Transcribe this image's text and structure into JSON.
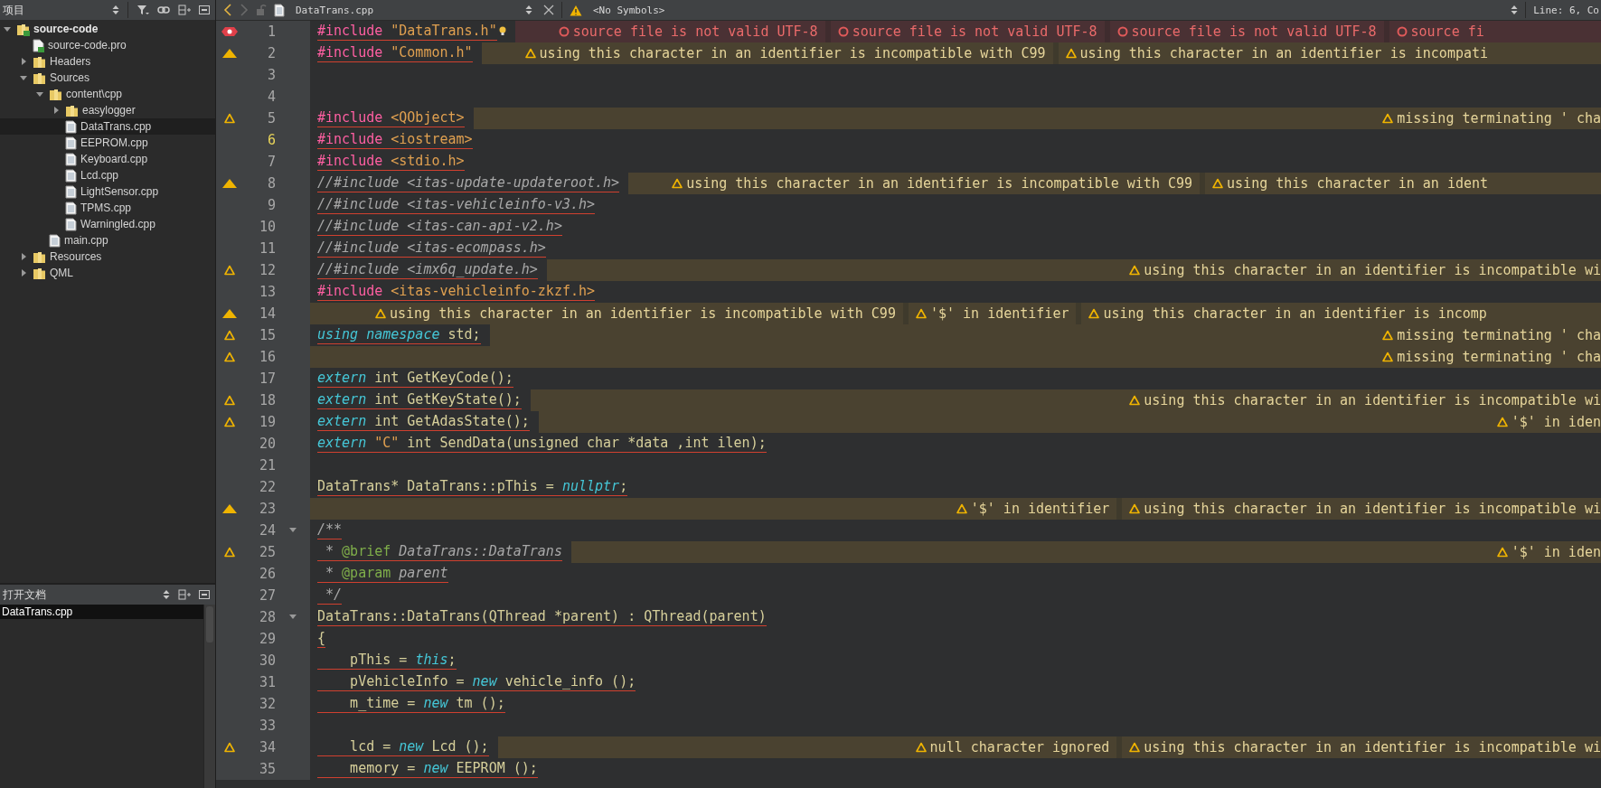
{
  "project_panel": {
    "title": "项目",
    "tree": [
      {
        "label": "source-code",
        "kind": "project",
        "expanded": true,
        "selected": false,
        "children": [
          {
            "label": "source-code.pro",
            "kind": "profile",
            "selected": false
          },
          {
            "label": "Headers",
            "kind": "folder",
            "expanded": false,
            "selected": false
          },
          {
            "label": "Sources",
            "kind": "folder",
            "expanded": true,
            "selected": false,
            "children": [
              {
                "label": "content\\cpp",
                "kind": "folder",
                "expanded": true,
                "selected": false,
                "children": [
                  {
                    "label": "easylogger",
                    "kind": "folder",
                    "expanded": false,
                    "selected": false
                  },
                  {
                    "label": "DataTrans.cpp",
                    "kind": "file",
                    "selected": true
                  },
                  {
                    "label": "EEPROM.cpp",
                    "kind": "file",
                    "selected": false
                  },
                  {
                    "label": "Keyboard.cpp",
                    "kind": "file",
                    "selected": false
                  },
                  {
                    "label": "Lcd.cpp",
                    "kind": "file",
                    "selected": false
                  },
                  {
                    "label": "LightSensor.cpp",
                    "kind": "file",
                    "selected": false
                  },
                  {
                    "label": "TPMS.cpp",
                    "kind": "file",
                    "selected": false
                  },
                  {
                    "label": "Warningled.cpp",
                    "kind": "file",
                    "selected": false
                  }
                ]
              },
              {
                "label": "main.cpp",
                "kind": "file",
                "selected": false
              }
            ]
          },
          {
            "label": "Resources",
            "kind": "folder",
            "expanded": false,
            "selected": false
          },
          {
            "label": "QML",
            "kind": "folder",
            "expanded": false,
            "selected": false
          }
        ]
      }
    ]
  },
  "open_documents": {
    "title": "打开文档",
    "items": [
      {
        "label": "DataTrans.cpp",
        "selected": true
      }
    ]
  },
  "editor_toolbar": {
    "file": "DataTrans.cpp",
    "symbols": "<No Symbols>",
    "position": "Line: 6, Co"
  },
  "lines": [
    {
      "number": "1",
      "kind": "error",
      "current": false,
      "fold": false,
      "underlined": true,
      "bulb": true,
      "right_aligned": false,
      "code": [
        {
          "kind": "pp",
          "text": "#include "
        },
        {
          "kind": "str",
          "text": "\"DataTrans.h\""
        }
      ],
      "annotations": [
        {
          "kind": "error",
          "text": "source file is not valid UTF-8"
        },
        {
          "kind": "error",
          "text": "source file is not valid UTF-8"
        },
        {
          "kind": "error",
          "text": "source file is not valid UTF-8"
        },
        {
          "kind": "error",
          "text": "source fi"
        }
      ]
    },
    {
      "number": "2",
      "kind": "warning",
      "current": false,
      "fold": false,
      "underlined": true,
      "bulb": false,
      "right_aligned": false,
      "code": [
        {
          "kind": "pp",
          "text": "#include "
        },
        {
          "kind": "str",
          "text": "\"Common.h\""
        }
      ],
      "annotations": [
        {
          "kind": "warning",
          "text": "using this character in an identifier is incompatible with C99"
        },
        {
          "kind": "warning",
          "text": "using this character in an identifier is incompati"
        }
      ]
    },
    {
      "number": "3",
      "kind": "plain",
      "current": false,
      "fold": false,
      "bulb": false
    },
    {
      "number": "4",
      "kind": "plain",
      "current": false,
      "fold": false,
      "bulb": false
    },
    {
      "number": "5",
      "kind": "warning-outline",
      "current": false,
      "fold": false,
      "underlined": true,
      "bulb": false,
      "right_aligned": true,
      "code": [
        {
          "kind": "pp",
          "text": "#include "
        },
        {
          "kind": "str",
          "text": "<QObject>"
        }
      ],
      "annotations": [
        {
          "kind": "warning",
          "text": "missing terminating ' cha"
        }
      ]
    },
    {
      "number": "6",
      "kind": "plain",
      "current": true,
      "fold": false,
      "underlined": true,
      "bulb": false,
      "code": [
        {
          "kind": "pp",
          "text": "#include "
        },
        {
          "kind": "str",
          "text": "<iostream>"
        }
      ]
    },
    {
      "number": "7",
      "kind": "plain",
      "current": false,
      "fold": false,
      "underlined": true,
      "bulb": false,
      "code": [
        {
          "kind": "pp",
          "text": "#include "
        },
        {
          "kind": "str",
          "text": "<stdio.h>"
        }
      ]
    },
    {
      "number": "8",
      "kind": "warning",
      "current": false,
      "fold": false,
      "underlined": true,
      "bulb": false,
      "right_aligned": false,
      "code": [
        {
          "kind": "cmt",
          "text": "//#include <itas-update-updateroot.h>"
        }
      ],
      "annotations": [
        {
          "kind": "warning",
          "text": "using this character in an identifier is incompatible with C99"
        },
        {
          "kind": "warning",
          "text": "using this character in an ident"
        }
      ]
    },
    {
      "number": "9",
      "kind": "plain",
      "current": false,
      "fold": false,
      "underlined": true,
      "bulb": false,
      "code": [
        {
          "kind": "cmt",
          "text": "//#include <itas-vehicleinfo-v3.h>"
        }
      ]
    },
    {
      "number": "10",
      "kind": "plain",
      "current": false,
      "fold": false,
      "underlined": true,
      "bulb": false,
      "code": [
        {
          "kind": "cmt",
          "text": "//#include <itas-can-api-v2.h>"
        }
      ]
    },
    {
      "number": "11",
      "kind": "plain",
      "current": false,
      "fold": false,
      "underlined": true,
      "bulb": false,
      "code": [
        {
          "kind": "cmt",
          "text": "//#include <itas-ecompass.h>"
        }
      ]
    },
    {
      "number": "12",
      "kind": "warning-outline",
      "current": false,
      "fold": false,
      "underlined": true,
      "bulb": false,
      "right_aligned": true,
      "code": [
        {
          "kind": "cmt",
          "text": "//#include <imx6q_update.h>"
        }
      ],
      "annotations": [
        {
          "kind": "warning",
          "text": "using this character in an identifier is incompatible wi"
        }
      ]
    },
    {
      "number": "13",
      "kind": "plain",
      "current": false,
      "fold": false,
      "underlined": true,
      "bulb": false,
      "code": [
        {
          "kind": "pp",
          "text": "#include "
        },
        {
          "kind": "str",
          "text": "<itas-vehicleinfo-zkzf.h>"
        }
      ]
    },
    {
      "number": "14",
      "kind": "warning",
      "current": false,
      "fold": false,
      "bulb": false,
      "right_aligned": false,
      "annotations": [
        {
          "kind": "warning",
          "text": "using this character in an identifier is incompatible with C99"
        },
        {
          "kind": "warning",
          "text": "'$' in identifier"
        },
        {
          "kind": "warning",
          "text": "using this character in an identifier is incomp"
        }
      ]
    },
    {
      "number": "15",
      "kind": "warning-outline",
      "current": false,
      "fold": false,
      "underlined": true,
      "bulb": false,
      "right_aligned": true,
      "code": [
        {
          "kind": "kw",
          "text": "using namespace"
        },
        {
          "kind": "plain",
          "text": " std;"
        }
      ],
      "annotations": [
        {
          "kind": "warning",
          "text": "missing terminating ' cha"
        }
      ]
    },
    {
      "number": "16",
      "kind": "warning-outline",
      "current": false,
      "fold": false,
      "bulb": false,
      "right_aligned": true,
      "annotations": [
        {
          "kind": "warning",
          "text": "missing terminating ' cha"
        }
      ]
    },
    {
      "number": "17",
      "kind": "plain",
      "current": false,
      "fold": false,
      "underlined": true,
      "bulb": false,
      "code": [
        {
          "kind": "kw",
          "text": "extern"
        },
        {
          "kind": "plain",
          "text": " int GetKeyCode();"
        }
      ]
    },
    {
      "number": "18",
      "kind": "warning-outline",
      "current": false,
      "fold": false,
      "underlined": true,
      "bulb": false,
      "right_aligned": true,
      "code": [
        {
          "kind": "kw",
          "text": "extern"
        },
        {
          "kind": "plain",
          "text": " int GetKeyState();"
        }
      ],
      "annotations": [
        {
          "kind": "warning",
          "text": "using this character in an identifier is incompatible wi"
        }
      ]
    },
    {
      "number": "19",
      "kind": "warning-outline",
      "current": false,
      "fold": false,
      "underlined": true,
      "bulb": false,
      "right_aligned": true,
      "code": [
        {
          "kind": "kw",
          "text": "extern"
        },
        {
          "kind": "plain",
          "text": " int GetAdasState();"
        }
      ],
      "annotations": [
        {
          "kind": "warning",
          "text": "'$' in iden"
        }
      ]
    },
    {
      "number": "20",
      "kind": "plain",
      "current": false,
      "fold": false,
      "underlined": true,
      "bulb": false,
      "code": [
        {
          "kind": "kw",
          "text": "extern"
        },
        {
          "kind": "str",
          "text": " \"C\""
        },
        {
          "kind": "plain",
          "text": " int SendData(unsigned char *data ,int ilen);"
        }
      ]
    },
    {
      "number": "21",
      "kind": "plain",
      "current": false,
      "fold": false,
      "bulb": false
    },
    {
      "number": "22",
      "kind": "plain",
      "current": false,
      "fold": false,
      "underlined": true,
      "bulb": false,
      "code": [
        {
          "kind": "plain",
          "text": "DataTrans* DataTrans::pThis = "
        },
        {
          "kind": "kw",
          "text": "nullptr"
        },
        {
          "kind": "plain",
          "text": ";"
        }
      ]
    },
    {
      "number": "23",
      "kind": "warning",
      "current": false,
      "fold": false,
      "bulb": false,
      "right_aligned": true,
      "annotations": [
        {
          "kind": "warning",
          "text": "'$' in identifier"
        },
        {
          "kind": "warning",
          "text": "using this character in an identifier is incompatible wi"
        }
      ]
    },
    {
      "number": "24",
      "kind": "plain",
      "current": false,
      "fold": true,
      "underlined": true,
      "bulb": false,
      "code": [
        {
          "kind": "cmt",
          "text": "/**"
        }
      ]
    },
    {
      "number": "25",
      "kind": "warning-outline",
      "current": false,
      "fold": false,
      "underlined": true,
      "bulb": false,
      "right_aligned": true,
      "code": [
        {
          "kind": "cmt",
          "text": " * "
        },
        {
          "kind": "doctag",
          "text": "@brief"
        },
        {
          "kind": "cmt",
          "text": " DataTrans::DataTrans"
        }
      ],
      "annotations": [
        {
          "kind": "warning",
          "text": "'$' in iden"
        }
      ]
    },
    {
      "number": "26",
      "kind": "plain",
      "current": false,
      "fold": false,
      "underlined": true,
      "bulb": false,
      "code": [
        {
          "kind": "cmt",
          "text": " * "
        },
        {
          "kind": "doctag",
          "text": "@param"
        },
        {
          "kind": "cmt",
          "text": " parent"
        }
      ]
    },
    {
      "number": "27",
      "kind": "plain",
      "current": false,
      "fold": false,
      "underlined": true,
      "bulb": false,
      "code": [
        {
          "kind": "cmt",
          "text": " */"
        }
      ]
    },
    {
      "number": "28",
      "kind": "plain",
      "current": false,
      "fold": true,
      "underlined": true,
      "bulb": false,
      "code": [
        {
          "kind": "plain",
          "text": "DataTrans::DataTrans(QThread *parent) : QThread(parent)"
        }
      ]
    },
    {
      "number": "29",
      "kind": "plain",
      "current": false,
      "fold": false,
      "underlined": true,
      "bulb": false,
      "code": [
        {
          "kind": "plain",
          "text": "{"
        }
      ]
    },
    {
      "number": "30",
      "kind": "plain",
      "current": false,
      "fold": false,
      "underlined": true,
      "bulb": false,
      "code": [
        {
          "kind": "plain",
          "text": "    pThis = "
        },
        {
          "kind": "kw",
          "text": "this"
        },
        {
          "kind": "plain",
          "text": ";"
        }
      ]
    },
    {
      "number": "31",
      "kind": "plain",
      "current": false,
      "fold": false,
      "underlined": true,
      "bulb": false,
      "code": [
        {
          "kind": "plain",
          "text": "    pVehicleInfo = "
        },
        {
          "kind": "kw",
          "text": "new"
        },
        {
          "kind": "plain",
          "text": " vehicle_info ();"
        }
      ]
    },
    {
      "number": "32",
      "kind": "plain",
      "current": false,
      "fold": false,
      "underlined": true,
      "bulb": false,
      "code": [
        {
          "kind": "plain",
          "text": "    m_time = "
        },
        {
          "kind": "kw",
          "text": "new"
        },
        {
          "kind": "plain",
          "text": " tm ();"
        }
      ]
    },
    {
      "number": "33",
      "kind": "plain",
      "current": false,
      "fold": false,
      "bulb": false
    },
    {
      "number": "34",
      "kind": "warning-outline",
      "current": false,
      "fold": false,
      "underlined": true,
      "bulb": false,
      "right_aligned": true,
      "code": [
        {
          "kind": "plain",
          "text": "    lcd = "
        },
        {
          "kind": "kw",
          "text": "new"
        },
        {
          "kind": "plain",
          "text": " Lcd ();"
        }
      ],
      "annotations": [
        {
          "kind": "warning",
          "text": "null character ignored"
        },
        {
          "kind": "warning",
          "text": "using this character in an identifier is incompatible wi"
        }
      ]
    },
    {
      "number": "35",
      "kind": "plain",
      "current": false,
      "fold": false,
      "underlined": true,
      "bulb": false,
      "code": [
        {
          "kind": "plain",
          "text": "    memory = "
        },
        {
          "kind": "kw",
          "text": "new"
        },
        {
          "kind": "plain",
          "text": " EEPROM ();"
        }
      ]
    }
  ]
}
